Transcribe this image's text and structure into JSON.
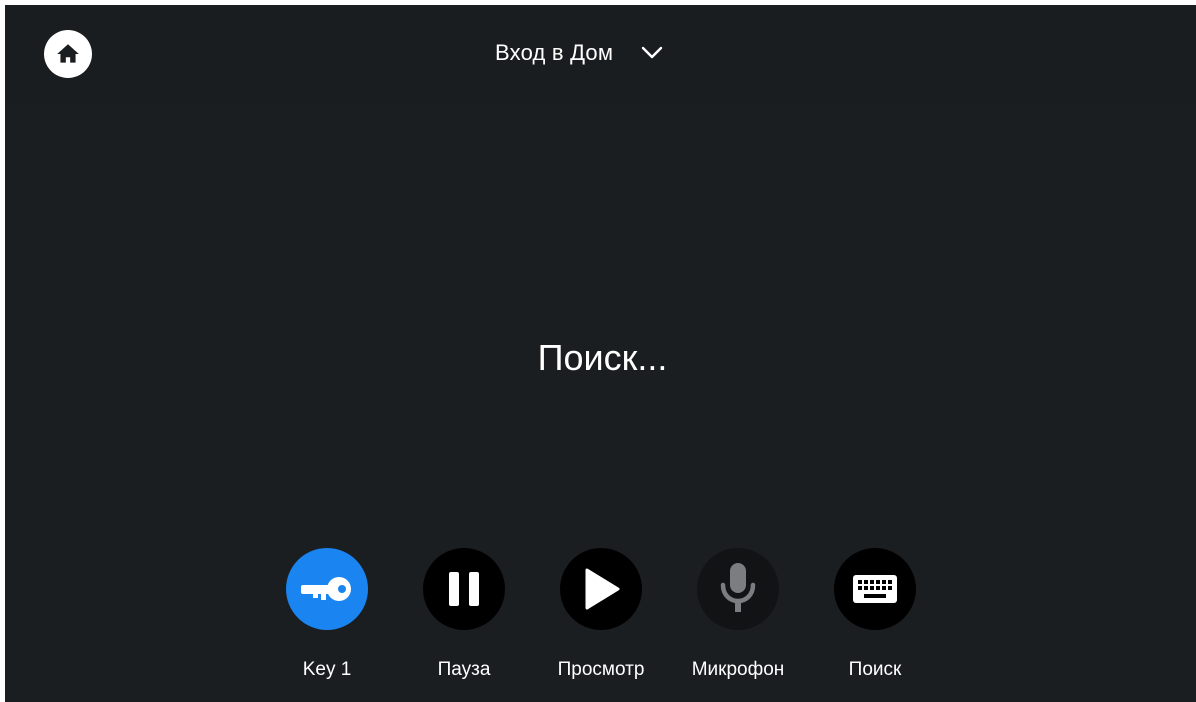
{
  "header": {
    "home_icon": "home-icon",
    "camera_name": "Вход в Дом",
    "dropdown_icon": "chevron-down-icon"
  },
  "main": {
    "status_text": "Поиск..."
  },
  "controls": [
    {
      "label": "Key 1",
      "icon": "key-icon",
      "color": "#1a84f0",
      "active": true
    },
    {
      "label": "Пауза",
      "icon": "pause-icon",
      "color": "#000000"
    },
    {
      "label": "Просмотр",
      "icon": "play-icon",
      "color": "#000000"
    },
    {
      "label": "Микрофон",
      "icon": "microphone-icon",
      "color": "#111315",
      "disabled": true
    },
    {
      "label": "Поиск",
      "icon": "keyboard-icon",
      "color": "#000000"
    }
  ]
}
